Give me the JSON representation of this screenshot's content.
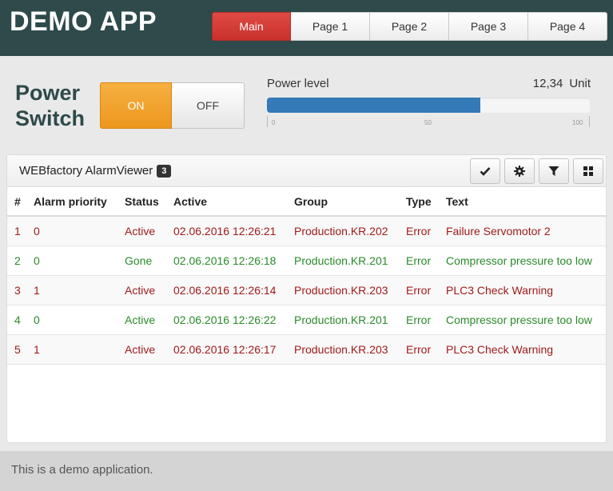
{
  "app": {
    "title": "DEMO APP"
  },
  "nav": {
    "tabs": [
      "Main",
      "Page 1",
      "Page 2",
      "Page 3",
      "Page 4"
    ],
    "active_index": 0
  },
  "power": {
    "label_line1": "Power",
    "label_line2": "Switch",
    "on_label": "ON",
    "off_label": "OFF",
    "state": "ON"
  },
  "power_level": {
    "label": "Power level",
    "value": "12,34",
    "unit": "Unit",
    "bar_fraction": 0.66,
    "scale_labels": [
      "0",
      "50",
      "100"
    ]
  },
  "alarm_viewer": {
    "title": "WEBfactory AlarmViewer",
    "badge": "3",
    "toolbar": [
      "check-icon",
      "gear-icon",
      "filter-icon",
      "grid-icon"
    ],
    "columns": [
      "#",
      "Alarm priority",
      "Status",
      "Active",
      "Group",
      "Type",
      "Text"
    ],
    "rows": [
      {
        "num": "1",
        "priority": "0",
        "status": "Active",
        "active": "02.06.2016 12:26:21",
        "group": "Production.KR.202",
        "type": "Error",
        "text": "Failure Servomotor 2",
        "style": "active"
      },
      {
        "num": "2",
        "priority": "0",
        "status": "Gone",
        "active": "02.06.2016 12:26:18",
        "group": "Production.KR.201",
        "type": "Error",
        "text": "Compressor pressure too low",
        "style": "gone"
      },
      {
        "num": "3",
        "priority": "1",
        "status": "Active",
        "active": "02.06.2016 12:26:14",
        "group": "Production.KR.203",
        "type": "Error",
        "text": "PLC3 Check Warning",
        "style": "active"
      },
      {
        "num": "4",
        "priority": "0",
        "status": "Active",
        "active": "02.06.2016 12:26:22",
        "group": "Production.KR.201",
        "type": "Error",
        "text": "Compressor pressure too low",
        "style": "gone"
      },
      {
        "num": "5",
        "priority": "1",
        "status": "Active",
        "active": "02.06.2016 12:26:17",
        "group": "Production.KR.203",
        "type": "Error",
        "text": "PLC3 Check Warning",
        "style": "active"
      }
    ]
  },
  "footer": {
    "text": "This is a demo application."
  },
  "colors": {
    "header_bg": "#2e4a4a",
    "nav_active": "#c9302c",
    "switch_on": "#ec971f",
    "bar_fill": "#337ab7",
    "alarm_active": "#a01a1a",
    "alarm_gone": "#2a8a2a"
  }
}
